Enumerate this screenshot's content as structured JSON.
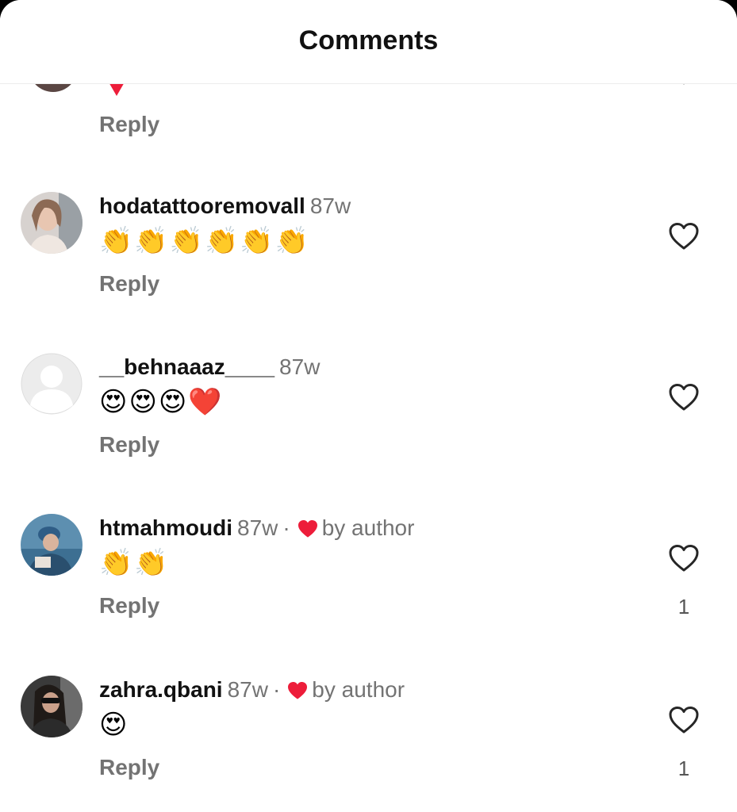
{
  "header": {
    "title": "Comments"
  },
  "partial": {
    "reply_label": "Reply"
  },
  "comments": [
    {
      "username": "hodatattooremovall",
      "time": "87w",
      "text": "👏👏👏👏👏👏",
      "reply_label": "Reply",
      "liked_by_author": false,
      "like_count": ""
    },
    {
      "username": "__behnaaaz____",
      "time": "87w",
      "text": "😍😍😍❤️",
      "reply_label": "Reply",
      "liked_by_author": false,
      "like_count": ""
    },
    {
      "username": "htmahmoudi",
      "time": "87w",
      "separator": "·",
      "by_author": "by author",
      "text": "👏👏",
      "reply_label": "Reply",
      "liked_by_author": true,
      "like_count": "1"
    },
    {
      "username": "zahra.qbani",
      "time": "87w",
      "separator": "·",
      "by_author": "by author",
      "text": "😍",
      "reply_label": "Reply",
      "liked_by_author": true,
      "like_count": "1"
    }
  ],
  "colors": {
    "heart_red": "#ed1d3a",
    "muted": "#737373",
    "text": "#111111"
  }
}
